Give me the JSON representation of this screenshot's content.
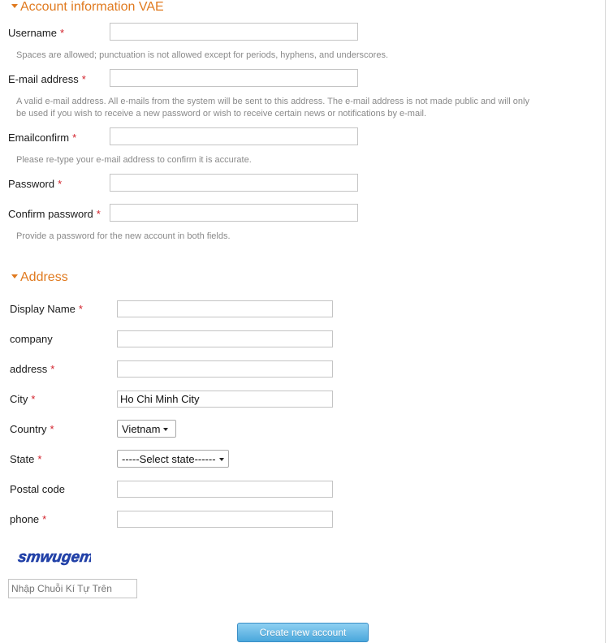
{
  "account_section": {
    "title": "Account information VAE",
    "username": {
      "label": "Username",
      "required": "*",
      "value": ""
    },
    "username_help": "Spaces are allowed; punctuation is not allowed except for periods, hyphens, and underscores.",
    "email": {
      "label": "E-mail address",
      "required": "*",
      "value": ""
    },
    "email_help_line1": "A valid e-mail address. All e-mails from the system will be sent to this address. The e-mail address is not made public and will only",
    "email_help_line2": "be used if you wish to receive a new password or wish to receive certain news or notifications by e-mail.",
    "emailconfirm": {
      "label": "Emailconfirm",
      "required": "*",
      "value": ""
    },
    "emailconfirm_help": "Please re-type your e-mail address to confirm it is accurate.",
    "password": {
      "label": "Password",
      "required": "*",
      "value": ""
    },
    "confirm_password": {
      "label": "Confirm password",
      "required": "*",
      "value": ""
    },
    "password_help": "Provide a password for the new account in both fields."
  },
  "address_section": {
    "title": "Address",
    "display_name": {
      "label": "Display Name",
      "required": "*",
      "value": ""
    },
    "company": {
      "label": "company",
      "value": ""
    },
    "address": {
      "label": "address",
      "required": "*",
      "value": ""
    },
    "city": {
      "label": "City",
      "required": "*",
      "value": "Ho Chi Minh City"
    },
    "country": {
      "label": "Country",
      "required": "*",
      "selected": "Vietnam"
    },
    "state": {
      "label": "State",
      "required": "*",
      "selected": "-----Select state------"
    },
    "postal_code": {
      "label": "Postal code",
      "value": ""
    },
    "phone": {
      "label": "phone",
      "required": "*",
      "value": ""
    }
  },
  "captcha": {
    "text": "smwugem",
    "input_placeholder": "Nhập Chuỗi Kí Tự Trên"
  },
  "submit": {
    "label": "Create new account"
  },
  "colors": {
    "section_title": "#e07a1f",
    "required_marker": "#d2202a",
    "help_text": "#8a8a8a",
    "button_top": "#8fd0f2",
    "button_bottom": "#4aa7dc",
    "captcha_text": "#2342a8"
  }
}
